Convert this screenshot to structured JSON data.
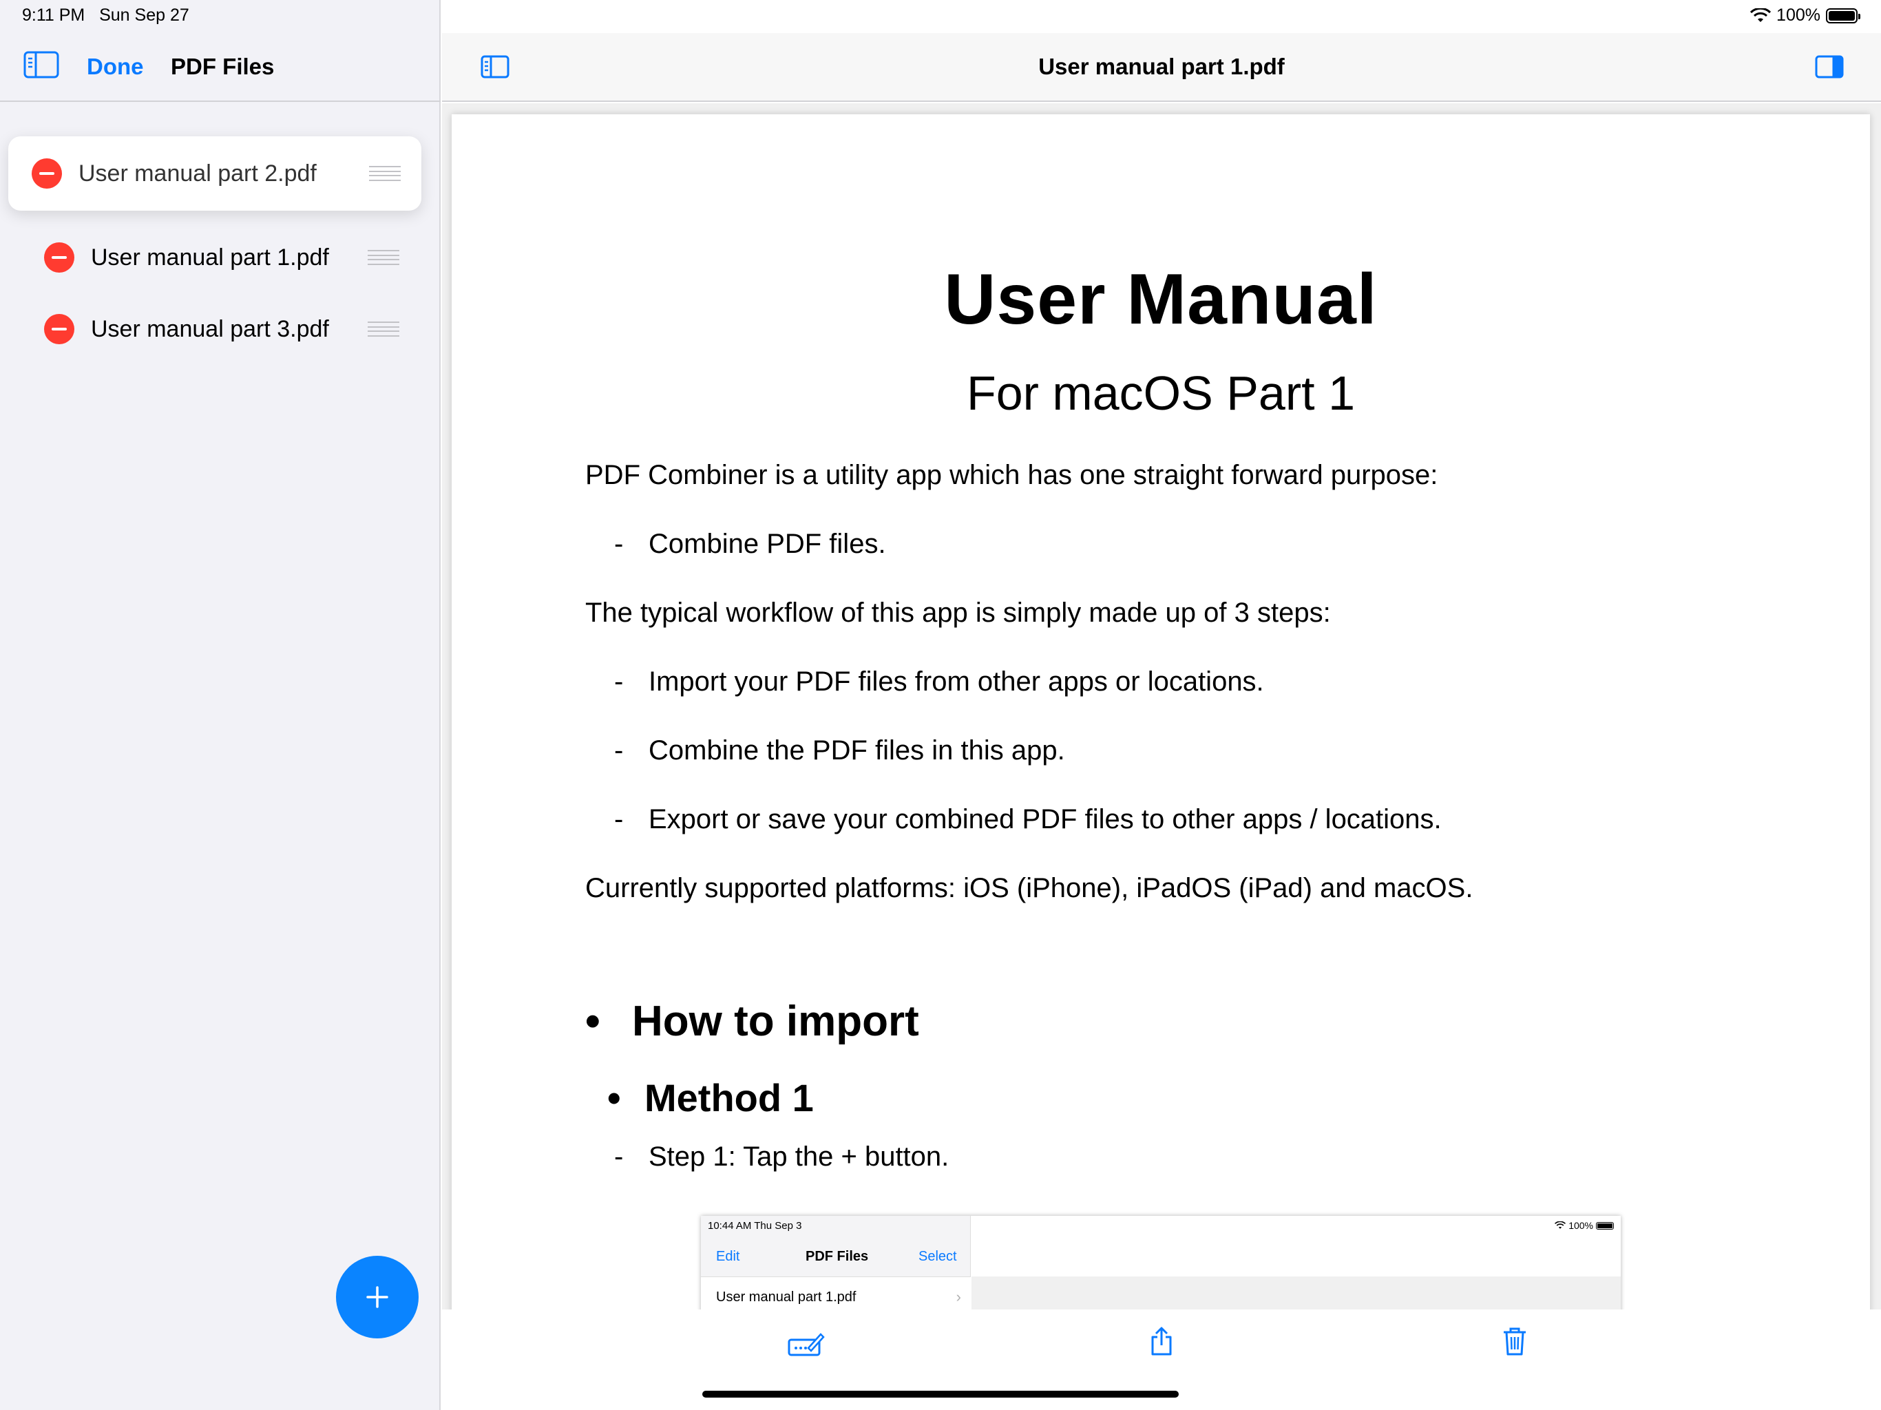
{
  "status_bar": {
    "time": "9:11 PM",
    "date": "Sun Sep 27",
    "battery": "100%"
  },
  "sidebar": {
    "done_label": "Done",
    "title": "PDF Files",
    "files": [
      {
        "name": "User manual part 2.pdf"
      },
      {
        "name": "User manual part 1.pdf"
      },
      {
        "name": "User manual part 3.pdf"
      }
    ]
  },
  "main": {
    "title": "User manual part 1.pdf"
  },
  "document": {
    "title": "User Manual",
    "subtitle": "For macOS Part 1",
    "intro": "PDF Combiner is a utility app which has one straight forward purpose:",
    "purpose_items": [
      "Combine PDF files."
    ],
    "workflow_intro": "The typical workflow of this app is simply made up of 3 steps:",
    "workflow_items": [
      "Import your PDF files from other apps or locations.",
      "Combine the PDF files in this app.",
      "Export or save your combined PDF files to other apps / locations."
    ],
    "platforms": "Currently supported platforms: iOS (iPhone), iPadOS (iPad) and macOS.",
    "section_heading": "How to import",
    "method_heading": "Method 1",
    "step_1": "Step 1: Tap the + button.",
    "bullet": "•",
    "dash": "-"
  },
  "embedded_screenshot": {
    "time": "10:44 AM  Thu Sep 3",
    "edit_label": "Edit",
    "title": "PDF Files",
    "select_label": "Select",
    "row_text": "User manual part 1.pdf",
    "battery": "100%"
  }
}
